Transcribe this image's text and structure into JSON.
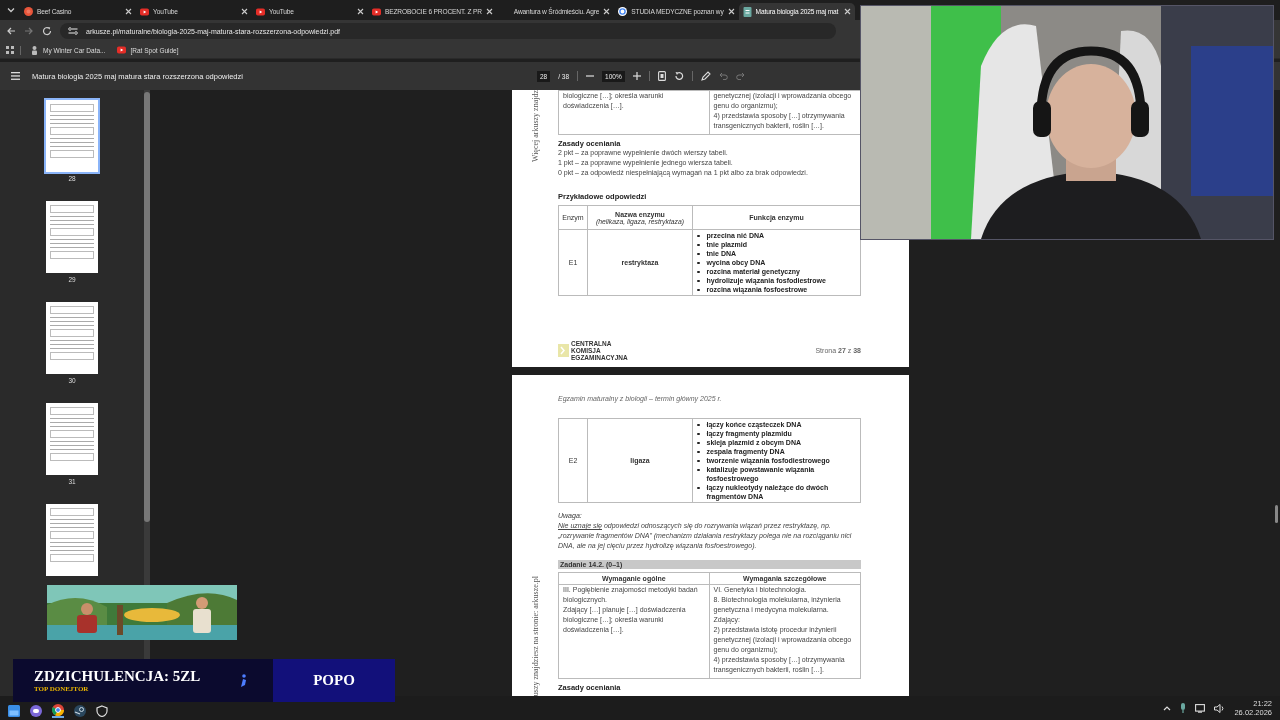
{
  "browser": {
    "tabs": [
      {
        "title": "Beef Casino",
        "selected": false
      },
      {
        "title": "YouTube",
        "selected": false
      },
      {
        "title": "YouTube",
        "selected": false
      },
      {
        "title": "BEZROBOCIE 6 PROCENT. Z PR",
        "selected": false
      },
      {
        "title": "Awantura w Śródmieściu. Agre",
        "selected": false
      },
      {
        "title": "STUDIA MEDYCZNE poznan wy",
        "selected": false
      },
      {
        "title": "Matura biologia 2025 maj mat",
        "selected": true
      }
    ],
    "address": "arkusze.pl/maturalne/biologia-2025-maj-matura-stara-rozszerzona-odpowiedzi.pdf",
    "bookmarks": [
      {
        "title": "My Winter Car Data..."
      },
      {
        "title": "[Rat Spot Guide]"
      }
    ]
  },
  "pdf_toolbar": {
    "title": "Matura biologia 2025 maj matura stara rozszerzona odpowiedzi",
    "page": "28",
    "total": "/ 38",
    "zoom": "100%"
  },
  "thumbnails": [
    {
      "label": "28",
      "selected": true
    },
    {
      "label": "29",
      "selected": false
    },
    {
      "label": "30",
      "selected": false
    },
    {
      "label": "31",
      "selected": false
    },
    {
      "selected": false
    }
  ],
  "pages": [
    {
      "side_text": "Więcej arkuszy znajdz",
      "blocks": [
        {
          "kind": "req_table",
          "cells": [
            [
              "biologiczne […]; określa warunki doświadczenia […]."
            ],
            [
              "genetycznej (izolacji i wprowadzania obcego genu do organizmu);",
              "4) przedstawia sposoby […] otrzymywania transgenicznych bakterii, roślin […]."
            ]
          ]
        },
        {
          "kind": "heading",
          "text": "Zasady oceniania"
        },
        {
          "kind": "lines",
          "lines": [
            "2 pkt – za poprawne wypełnienie dwóch wierszy tabeli.",
            "1 pkt – za poprawne wypełnienie jednego wiersza tabeli.",
            "0 pkt – za odpowiedź niespełniającą wymagań na 1 pkt albo za brak odpowiedzi."
          ]
        },
        {
          "kind": "heading",
          "text": "Przykładowe odpowiedzi"
        },
        {
          "kind": "answer_table",
          "columns": [
            {
              "text": "Enzym"
            },
            {
              "text": "Nazwa enzymu",
              "hint": "(helikaza, ligaza, restryktaza)"
            },
            {
              "text": "Funkcja enzymu"
            }
          ],
          "rows": [
            {
              "code": "E1",
              "name": "restryktaza",
              "functions": [
                "przecina nić DNA",
                "tnie plazmid",
                "tnie DNA",
                "wycina obcy DNA",
                "rozcina materiał genetyczny",
                "hydrolizuje wiązania fosfodiestrowe",
                "rozcina wiązania fosfoestrowe"
              ]
            }
          ]
        },
        {
          "kind": "footer",
          "logo": [
            "CENTRALNA",
            "KOMISJA",
            "EGZAMINACYJNA"
          ],
          "page": "Strona **27** z **38**"
        }
      ]
    },
    {
      "side_text": "uszy znajdziesz na stronie: arkusze.pl",
      "blocks": [
        {
          "kind": "header",
          "text": "Egzamin maturalny z biologii – termin główny 2025 r."
        },
        {
          "kind": "answer_table",
          "rows": [
            {
              "code": "E2",
              "name": "ligaza",
              "functions": [
                "łączy końce cząsteczek DNA",
                "łączy fragmenty plazmidu",
                "skleja plazmid z obcym DNA",
                "zespala fragmenty DNA",
                "tworzenie wiązania fosfodiestrowego",
                "katalizuje powstawanie wiązania fosfoestrowego",
                "łączy nukleotydy należące do dwóch fragmentów DNA"
              ]
            }
          ]
        },
        {
          "kind": "note",
          "title": "Uwaga:",
          "emphasis": "Nie uznaje się",
          "text": " odpowiedzi odnoszących się do rozrywania wiązań przez restryktazę, np. „rozrywanie fragmentów DNA” (mechanizm działania restryktazy polega nie na rozciąganiu nici DNA, ale na jej cięciu przez hydrolizę wiązania fosfoestrowego)."
        },
        {
          "kind": "task",
          "text": "Zadanie 14.2. (0–1)"
        },
        {
          "kind": "req_table",
          "columns": [
            "Wymaganie ogólne",
            "Wymagania szczegółowe"
          ],
          "cells": [
            [
              "III. Pogłębienie znajomości metodyki badań biologicznych.",
              "Zdający […] planuje […] doświadczenia biologiczne […]; określa warunki doświadczenia […]."
            ],
            [
              "VI. Genetyka i biotechnologia.",
              "8. Biotechnologia molekularna, inżynieria genetyczna i medycyna molekularna.",
              "Zdający:",
              "2) przedstawia istotę procedur inżynierii genetycznej (izolacji i wprowadzania obcego genu do organizmu);",
              "4) przedstawia sposoby […] otrzymywania transgenicznych bakterii, roślin […]."
            ]
          ]
        },
        {
          "kind": "heading",
          "text": "Zasady oceniania"
        }
      ]
    }
  ],
  "donation": {
    "donor": "ZDZICHULENCJA: 5ZL",
    "label": "TOP DONEJTOR",
    "name": "POPO"
  },
  "taskbar": {
    "time": "21:22",
    "date": "26.02.2026"
  }
}
